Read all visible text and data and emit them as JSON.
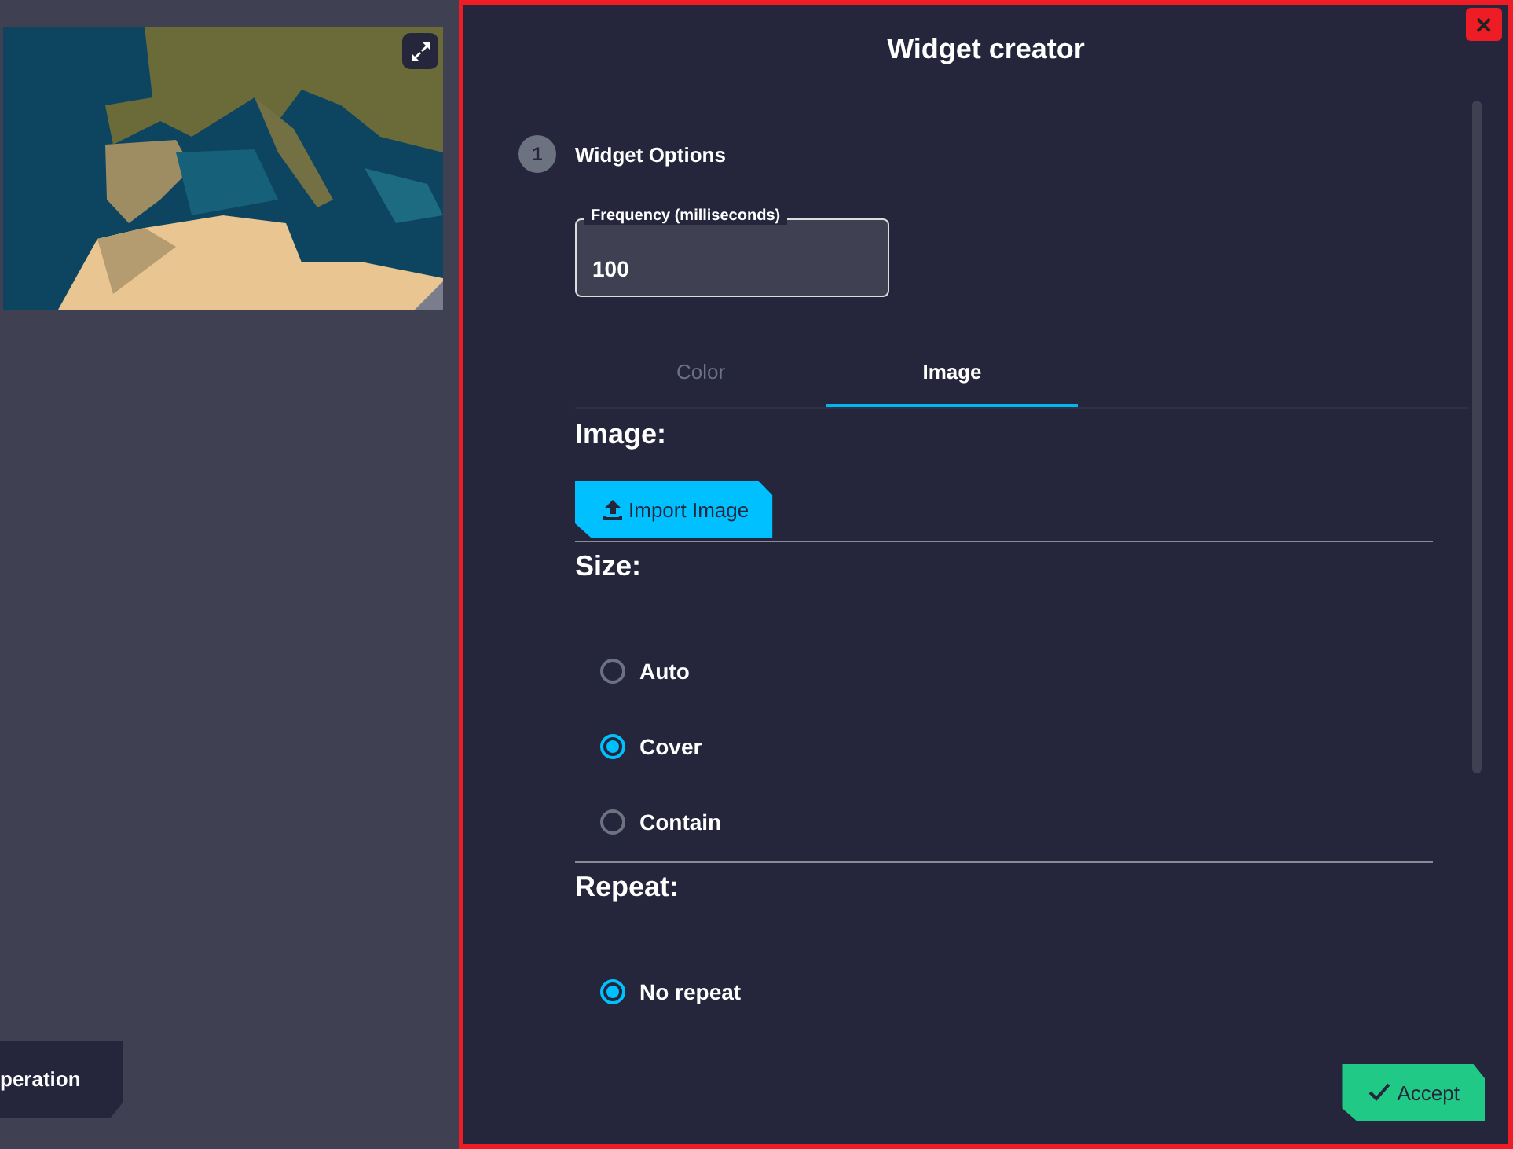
{
  "background": {
    "operation_button": "peration"
  },
  "dialog": {
    "title": "Widget creator",
    "close": "✕",
    "step": {
      "number": "1",
      "label": "Widget Options"
    },
    "frequency_field": {
      "label": "Frequency (milliseconds)",
      "value": "100"
    },
    "tabs": [
      {
        "label": "Color",
        "selected": false
      },
      {
        "label": "Image",
        "selected": true
      }
    ],
    "image_section": {
      "heading": "Image:",
      "import_button": "Import Image"
    },
    "size_section": {
      "heading": "Size:",
      "options": [
        {
          "label": "Auto",
          "selected": false
        },
        {
          "label": "Cover",
          "selected": true
        },
        {
          "label": "Contain",
          "selected": false
        }
      ]
    },
    "repeat_section": {
      "heading": "Repeat:",
      "options": [
        {
          "label": "No repeat",
          "selected": true
        }
      ]
    },
    "accept_button": "Accept"
  }
}
